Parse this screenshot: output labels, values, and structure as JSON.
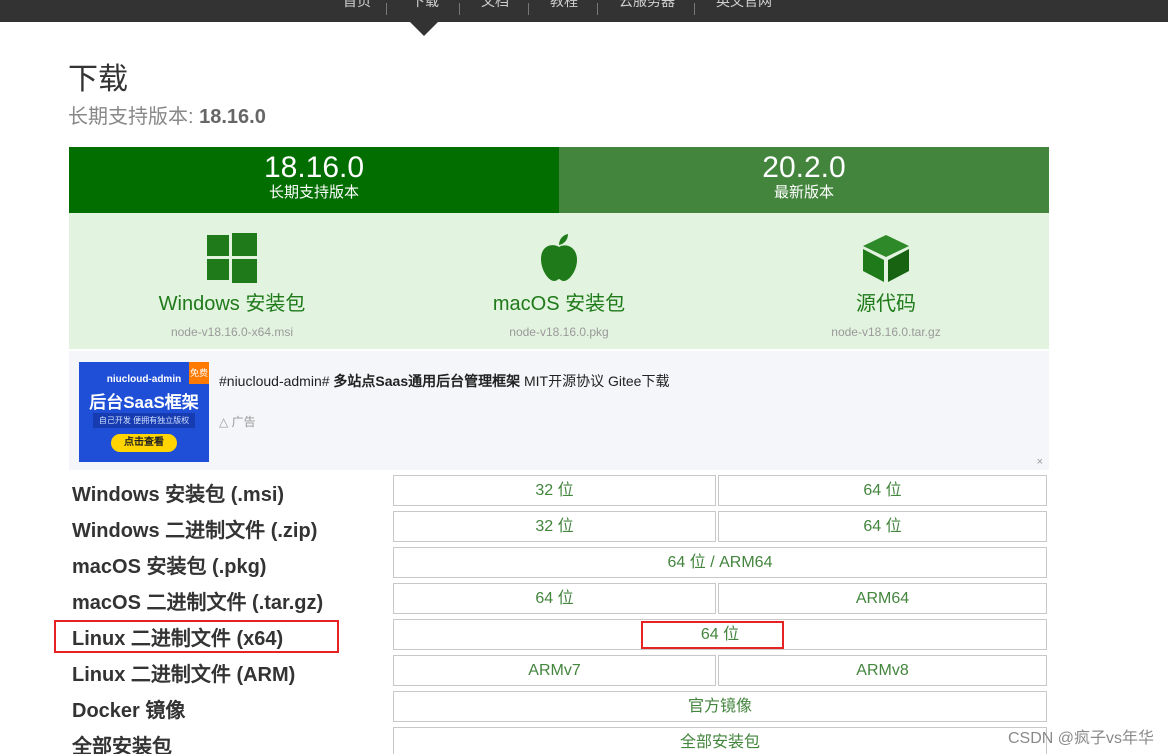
{
  "nav": {
    "items": [
      "首页",
      "下载",
      "文档",
      "教程",
      "云服务器",
      "英文官网"
    ]
  },
  "page": {
    "title": "下载",
    "subtitle_label": "长期支持版本:",
    "subtitle_version": "18.16.0"
  },
  "versions": {
    "lts": {
      "number": "18.16.0",
      "label": "长期支持版本"
    },
    "current": {
      "number": "20.2.0",
      "label": "最新版本"
    }
  },
  "packages": [
    {
      "icon": "windows-icon",
      "name": "Windows 安装包",
      "file": "node-v18.16.0-x64.msi"
    },
    {
      "icon": "apple-icon",
      "name": "macOS 安装包",
      "file": "node-v18.16.0.pkg"
    },
    {
      "icon": "box-icon",
      "name": "源代码",
      "file": "node-v18.16.0.tar.gz"
    }
  ],
  "ad": {
    "banner_title": "niucloud-admin",
    "banner_headline": "后台SaaS框架",
    "banner_sub": "自己开发 便拥有独立版权",
    "banner_button": "点击查看",
    "banner_badge": "免费",
    "text_prefix": "#niucloud-admin# ",
    "text_bold": "多站点Saas通用后台管理框架",
    "text_suffix": " MIT开源协议 Gitee下载",
    "tag": "广告",
    "close": "×"
  },
  "downloads": [
    {
      "label": "Windows 安装包 (.msi)",
      "cells": [
        "32 位",
        "64 位"
      ]
    },
    {
      "label": "Windows 二进制文件 (.zip)",
      "cells": [
        "32 位",
        "64 位"
      ]
    },
    {
      "label": "macOS 安装包 (.pkg)",
      "cells": [
        "64 位 / ARM64"
      ]
    },
    {
      "label": "macOS 二进制文件 (.tar.gz)",
      "cells": [
        "64 位",
        "ARM64"
      ]
    },
    {
      "label": "Linux 二进制文件 (x64)",
      "cells": [
        "64 位"
      ]
    },
    {
      "label": "Linux 二进制文件 (ARM)",
      "cells": [
        "ARMv7",
        "ARMv8"
      ]
    },
    {
      "label": "Docker 镜像",
      "cells": [
        "官方镜像"
      ]
    },
    {
      "label": "全部安装包",
      "cells": [
        "全部安装包"
      ]
    }
  ],
  "watermark": "CSDN @疯子vs年华",
  "colors": {
    "lts_green": "#026e00",
    "current_green": "#43853d",
    "package_bg": "#e2f3df",
    "highlight": "#e62222"
  }
}
